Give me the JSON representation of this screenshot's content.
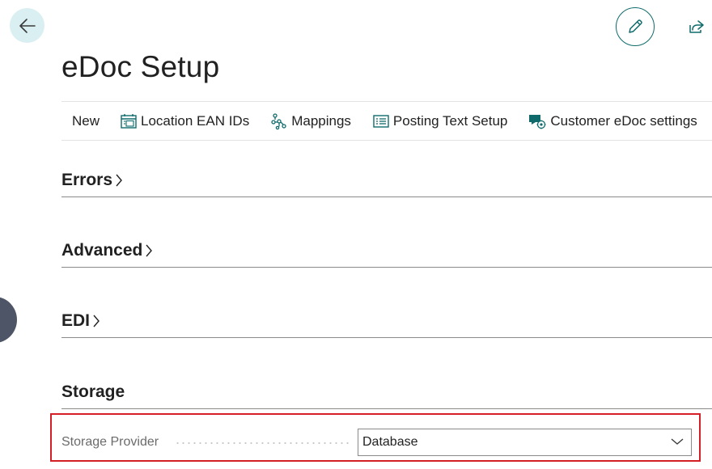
{
  "page": {
    "title": "eDoc Setup"
  },
  "colors": {
    "accent": "#0f6b6b",
    "back_button_bg": "#d9eff2",
    "highlight_border": "#d41f26"
  },
  "icons": {
    "back": "arrow-left-icon",
    "edit": "pencil-icon",
    "share": "share-icon"
  },
  "actions": [
    {
      "label": "New",
      "icon": ""
    },
    {
      "label": "Location EAN IDs",
      "icon": "calendar-grid-icon"
    },
    {
      "label": "Mappings",
      "icon": "mapping-tree-icon"
    },
    {
      "label": "Posting Text Setup",
      "icon": "list-card-icon"
    },
    {
      "label": "Customer eDoc settings",
      "icon": "customer-settings-icon"
    }
  ],
  "sections": [
    {
      "title": "Errors",
      "collapsed": true
    },
    {
      "title": "Advanced",
      "collapsed": true
    },
    {
      "title": "EDI",
      "collapsed": true
    },
    {
      "title": "Storage",
      "collapsed": false
    }
  ],
  "storage": {
    "provider_label": "Storage Provider",
    "provider_value": "Database"
  }
}
